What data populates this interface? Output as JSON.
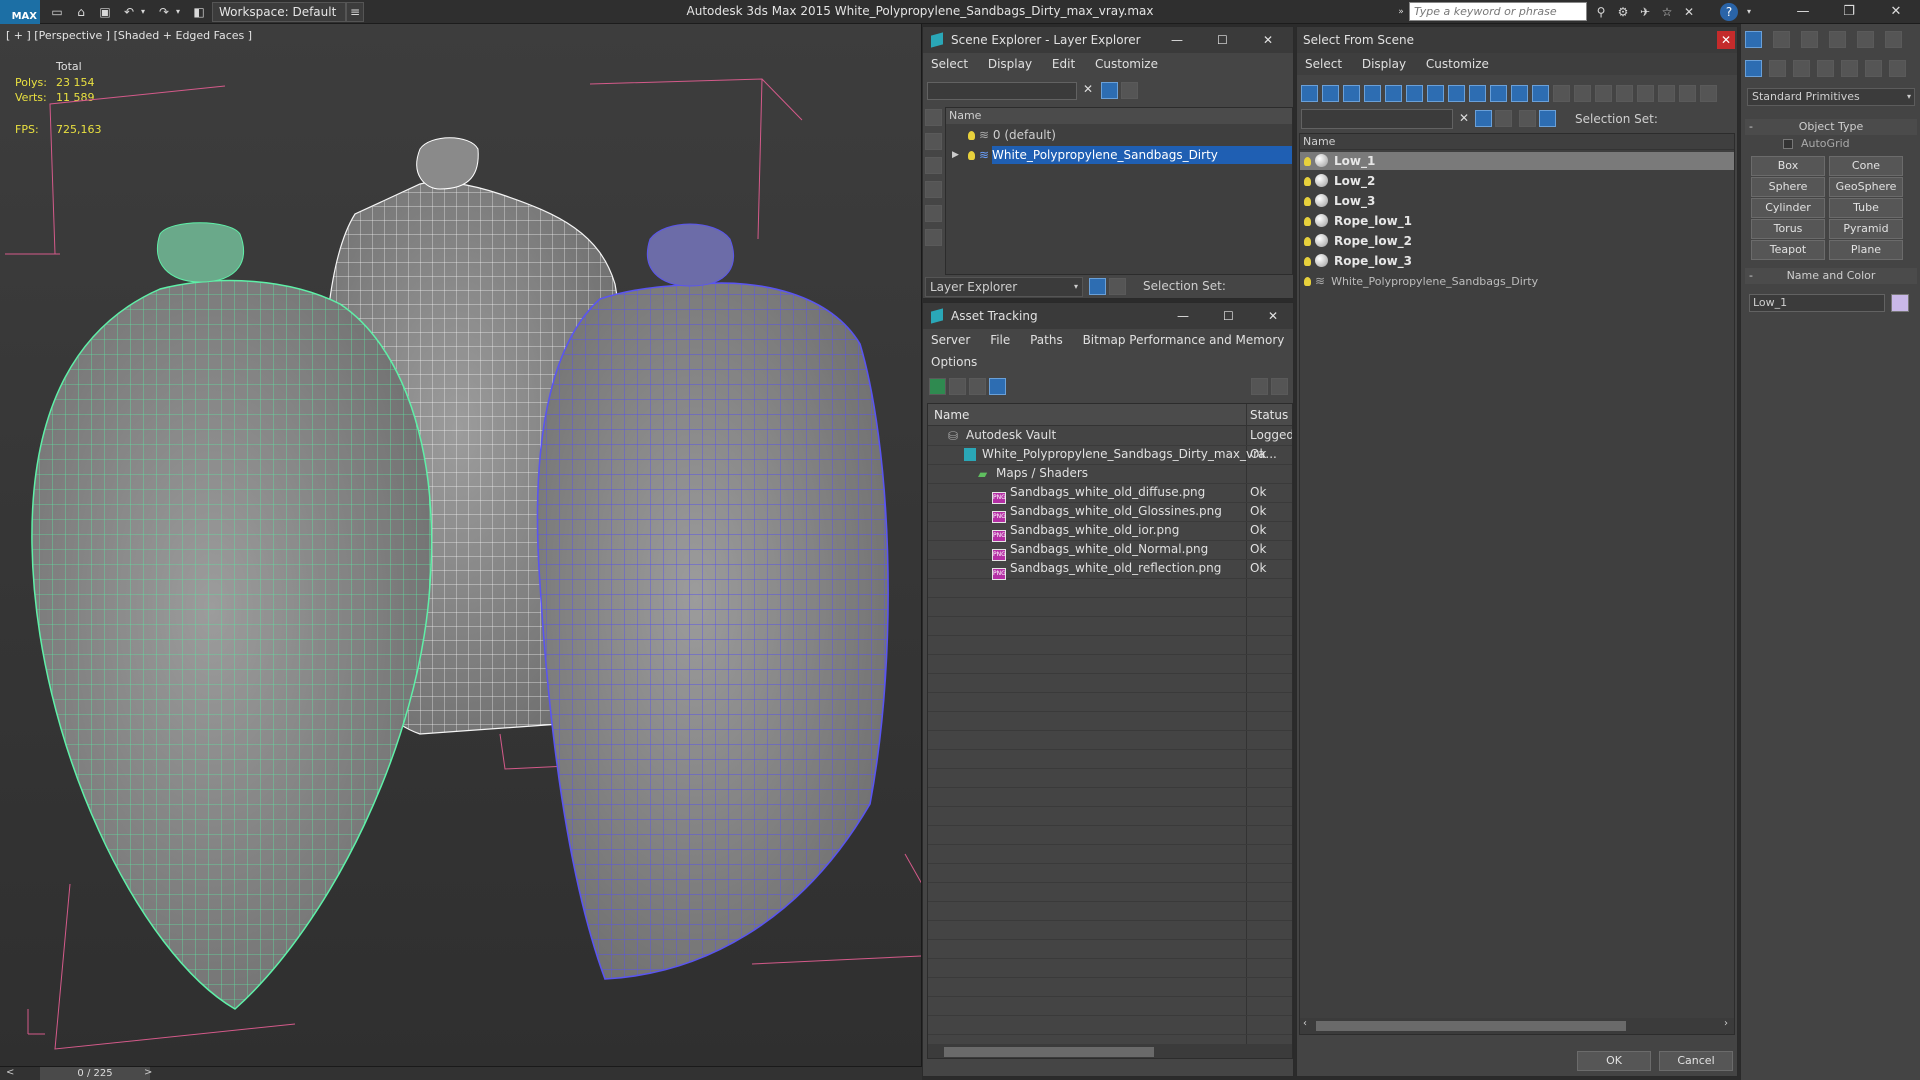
{
  "titlebar": {
    "logo": "MAX",
    "workspace": "Workspace: Default",
    "app_title": "Autodesk 3ds Max  2015    White_Polypropylene_Sandbags_Dirty_max_vray.max",
    "search_placeholder": "Type a keyword or phrase"
  },
  "viewport": {
    "label": "[ + ] [Perspective ] [Shaded + Edged Faces ]",
    "stats": {
      "header": "Total",
      "polys_label": "Polys:",
      "polys": "23 154",
      "verts_label": "Verts:",
      "verts": "11 589",
      "fps_label": "FPS:",
      "fps": "725,163"
    }
  },
  "timeline": {
    "frames": "0 / 225",
    "prev": "<",
    "next": ">"
  },
  "scene_explorer": {
    "title": "Scene Explorer - Layer Explorer",
    "menu": [
      "Select",
      "Display",
      "Edit",
      "Customize"
    ],
    "column": "Name",
    "rows": [
      "0 (default)",
      "White_Polypropylene_Sandbags_Dirty"
    ],
    "footer_dropdown": "Layer Explorer",
    "selection_set": "Selection Set:"
  },
  "asset_tracking": {
    "title": "Asset Tracking",
    "menu": [
      "Server",
      "File",
      "Paths",
      "Bitmap Performance and Memory"
    ],
    "menu2": "Options",
    "columns": [
      "Name",
      "Status"
    ],
    "rows": [
      {
        "name": "Autodesk Vault",
        "status": "Logged"
      },
      {
        "name": "White_Polypropylene_Sandbags_Dirty_max_vra...",
        "status": "Ok"
      },
      {
        "name": "Maps / Shaders",
        "status": ""
      },
      {
        "name": "Sandbags_white_old_diffuse.png",
        "status": "Ok"
      },
      {
        "name": "Sandbags_white_old_Glossines.png",
        "status": "Ok"
      },
      {
        "name": "Sandbags_white_old_ior.png",
        "status": "Ok"
      },
      {
        "name": "Sandbags_white_old_Normal.png",
        "status": "Ok"
      },
      {
        "name": "Sandbags_white_old_reflection.png",
        "status": "Ok"
      }
    ]
  },
  "select_from_scene": {
    "title": "Select From Scene",
    "menu": [
      "Select",
      "Display",
      "Customize"
    ],
    "selection_set": "Selection Set:",
    "column": "Name",
    "rows": [
      "Low_1",
      "Low_2",
      "Low_3",
      "Rope_low_1",
      "Rope_low_2",
      "Rope_low_3",
      "White_Polypropylene_Sandbags_Dirty"
    ],
    "ok": "OK",
    "cancel": "Cancel"
  },
  "command_panel": {
    "dropdown": "Standard Primitives",
    "object_type": "Object Type",
    "autogrid": "AutoGrid",
    "buttons": [
      "Box",
      "Cone",
      "Sphere",
      "GeoSphere",
      "Cylinder",
      "Tube",
      "Torus",
      "Pyramid",
      "Teapot",
      "Plane"
    ],
    "name_and_color": "Name and Color",
    "name_value": "Low_1",
    "color_swatch": "#c9b8e8"
  }
}
